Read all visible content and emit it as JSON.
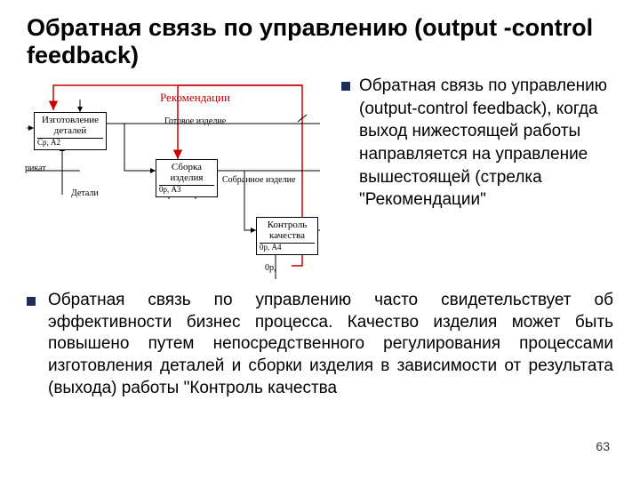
{
  "title": "Обратная связь по управлению (output -control feedback)",
  "top_bullet": "Обратная связь по управлению (output-control feedback), когда выход нижестоящей работы направляется на управление вышестоящей (стрелка \"Рекомендации\"",
  "bottom_bullet": "Обратная связь по управлению часто свидетельствует об эффективности бизнес процесса. Качество изделия может быть повышено путем непосредственного регулирования процессами изготовления деталей и сборки изделия в зависимости от результата (выхода) работы \"Контроль качества",
  "page_number": "63",
  "diagram": {
    "recommend_label": "Рекомендации",
    "box_a2": "Изготовление\nдеталей",
    "a2_sub": "Ср,           А2",
    "out_a2": "Готовое изделие",
    "in_left": "рикат",
    "details_label": "Детали",
    "box_a3": "Сборка\nизделия",
    "a3_sub": "0р,           А3",
    "out_a3": "Собранное изделие",
    "box_a4": "Контроль\nкачества",
    "a4_sub": "0р,           А4",
    "a4_mech": "0р,"
  }
}
